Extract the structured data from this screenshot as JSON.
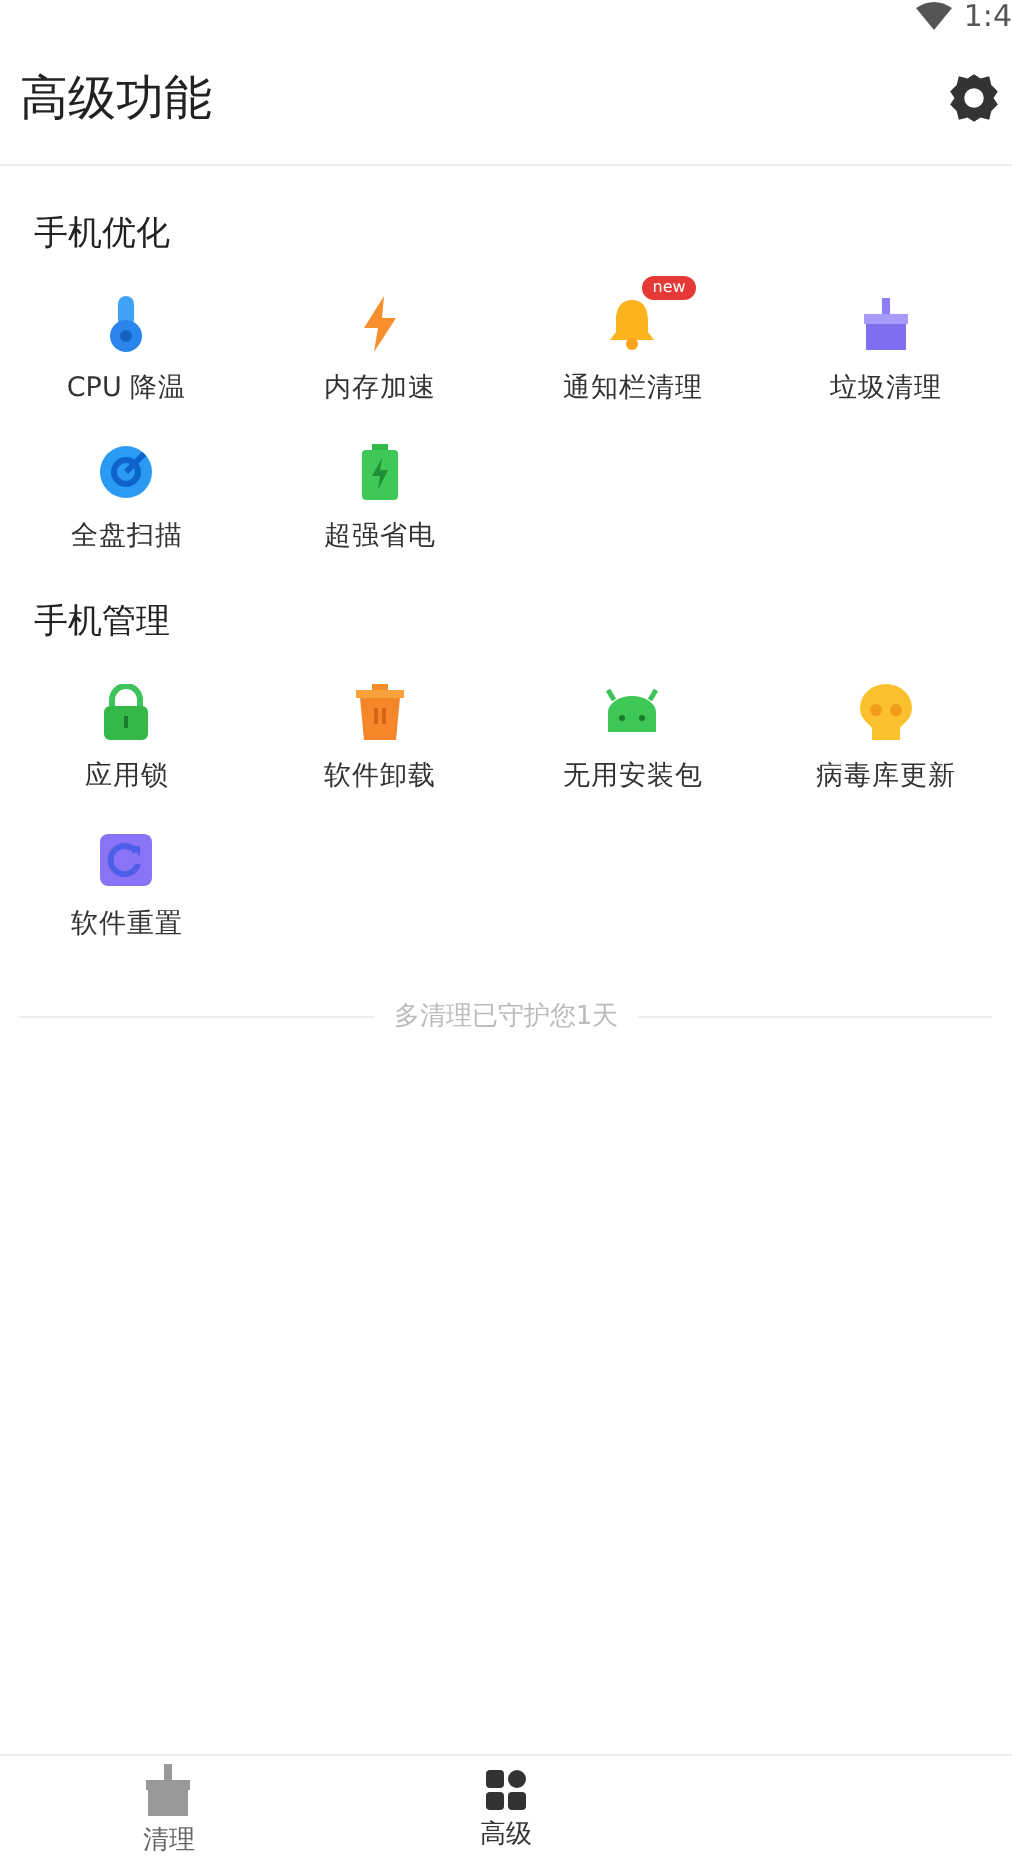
{
  "status_bar": {
    "time": "1:4"
  },
  "header": {
    "title": "高级功能"
  },
  "sections": [
    {
      "title": "手机优化",
      "items": [
        {
          "kind": "thermometer",
          "label": "CPU 降温"
        },
        {
          "kind": "bolt",
          "label": "内存加速"
        },
        {
          "kind": "bell",
          "label": "通知栏清理",
          "badge": "new"
        },
        {
          "kind": "broom",
          "label": "垃圾清理"
        },
        {
          "kind": "scan",
          "label": "全盘扫描"
        },
        {
          "kind": "battery",
          "label": "超强省电"
        }
      ]
    },
    {
      "title": "手机管理",
      "items": [
        {
          "kind": "lock",
          "label": "应用锁"
        },
        {
          "kind": "trash",
          "label": "软件卸载"
        },
        {
          "kind": "robot",
          "label": "无用安装包"
        },
        {
          "kind": "skull",
          "label": "病毒库更新"
        },
        {
          "kind": "reset",
          "label": "软件重置"
        }
      ]
    }
  ],
  "footer_note": "多清理已守护您1天",
  "bottom_nav": [
    {
      "kind": "broom",
      "label": "清理",
      "selected": false
    },
    {
      "kind": "grid",
      "label": "高级",
      "selected": true
    }
  ]
}
